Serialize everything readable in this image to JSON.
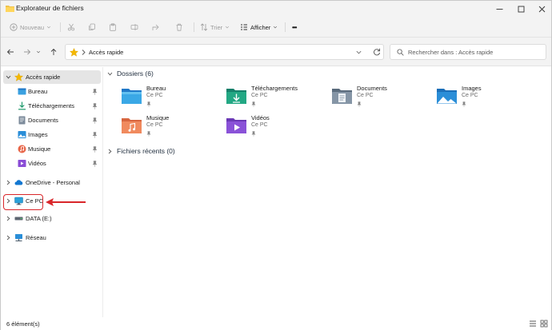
{
  "window": {
    "title": "Explorateur de fichiers"
  },
  "toolbar": {
    "new_label": "Nouveau",
    "sort_label": "Trier",
    "view_label": "Afficher",
    "more_label": "•••"
  },
  "address": {
    "path": "Accès rapide"
  },
  "search": {
    "placeholder": "Rechercher dans : Accès rapide"
  },
  "sidebar": {
    "quick_access": "Accès rapide",
    "items": [
      {
        "label": "Bureau",
        "icon": "desktop-folder-icon"
      },
      {
        "label": "Téléchargements",
        "icon": "download-icon"
      },
      {
        "label": "Documents",
        "icon": "documents-icon"
      },
      {
        "label": "Images",
        "icon": "images-icon"
      },
      {
        "label": "Musique",
        "icon": "music-icon"
      },
      {
        "label": "Vidéos",
        "icon": "videos-icon"
      }
    ],
    "onedrive": "OneDrive - Personal",
    "this_pc": "Ce PC",
    "data_drive": "DATA (E:)",
    "network": "Réseau"
  },
  "main": {
    "folders_header": "Dossiers (6)",
    "recent_header": "Fichiers récents (0)",
    "folders": [
      {
        "name": "Bureau",
        "location": "Ce PC",
        "icon": "desktop-folder-icon"
      },
      {
        "name": "Téléchargements",
        "location": "Ce PC",
        "icon": "downloads-folder-icon"
      },
      {
        "name": "Documents",
        "location": "Ce PC",
        "icon": "documents-folder-icon"
      },
      {
        "name": "Images",
        "location": "Ce PC",
        "icon": "images-folder-icon"
      },
      {
        "name": "Musique",
        "location": "Ce PC",
        "icon": "music-folder-icon"
      },
      {
        "name": "Vidéos",
        "location": "Ce PC",
        "icon": "videos-folder-icon"
      }
    ]
  },
  "status": {
    "count": "6 élément(s)"
  },
  "colors": {
    "accent": "#0067c0",
    "annotation": "#d9262a",
    "selected": "#e5e5e5",
    "chrome": "#f3f3f3"
  }
}
